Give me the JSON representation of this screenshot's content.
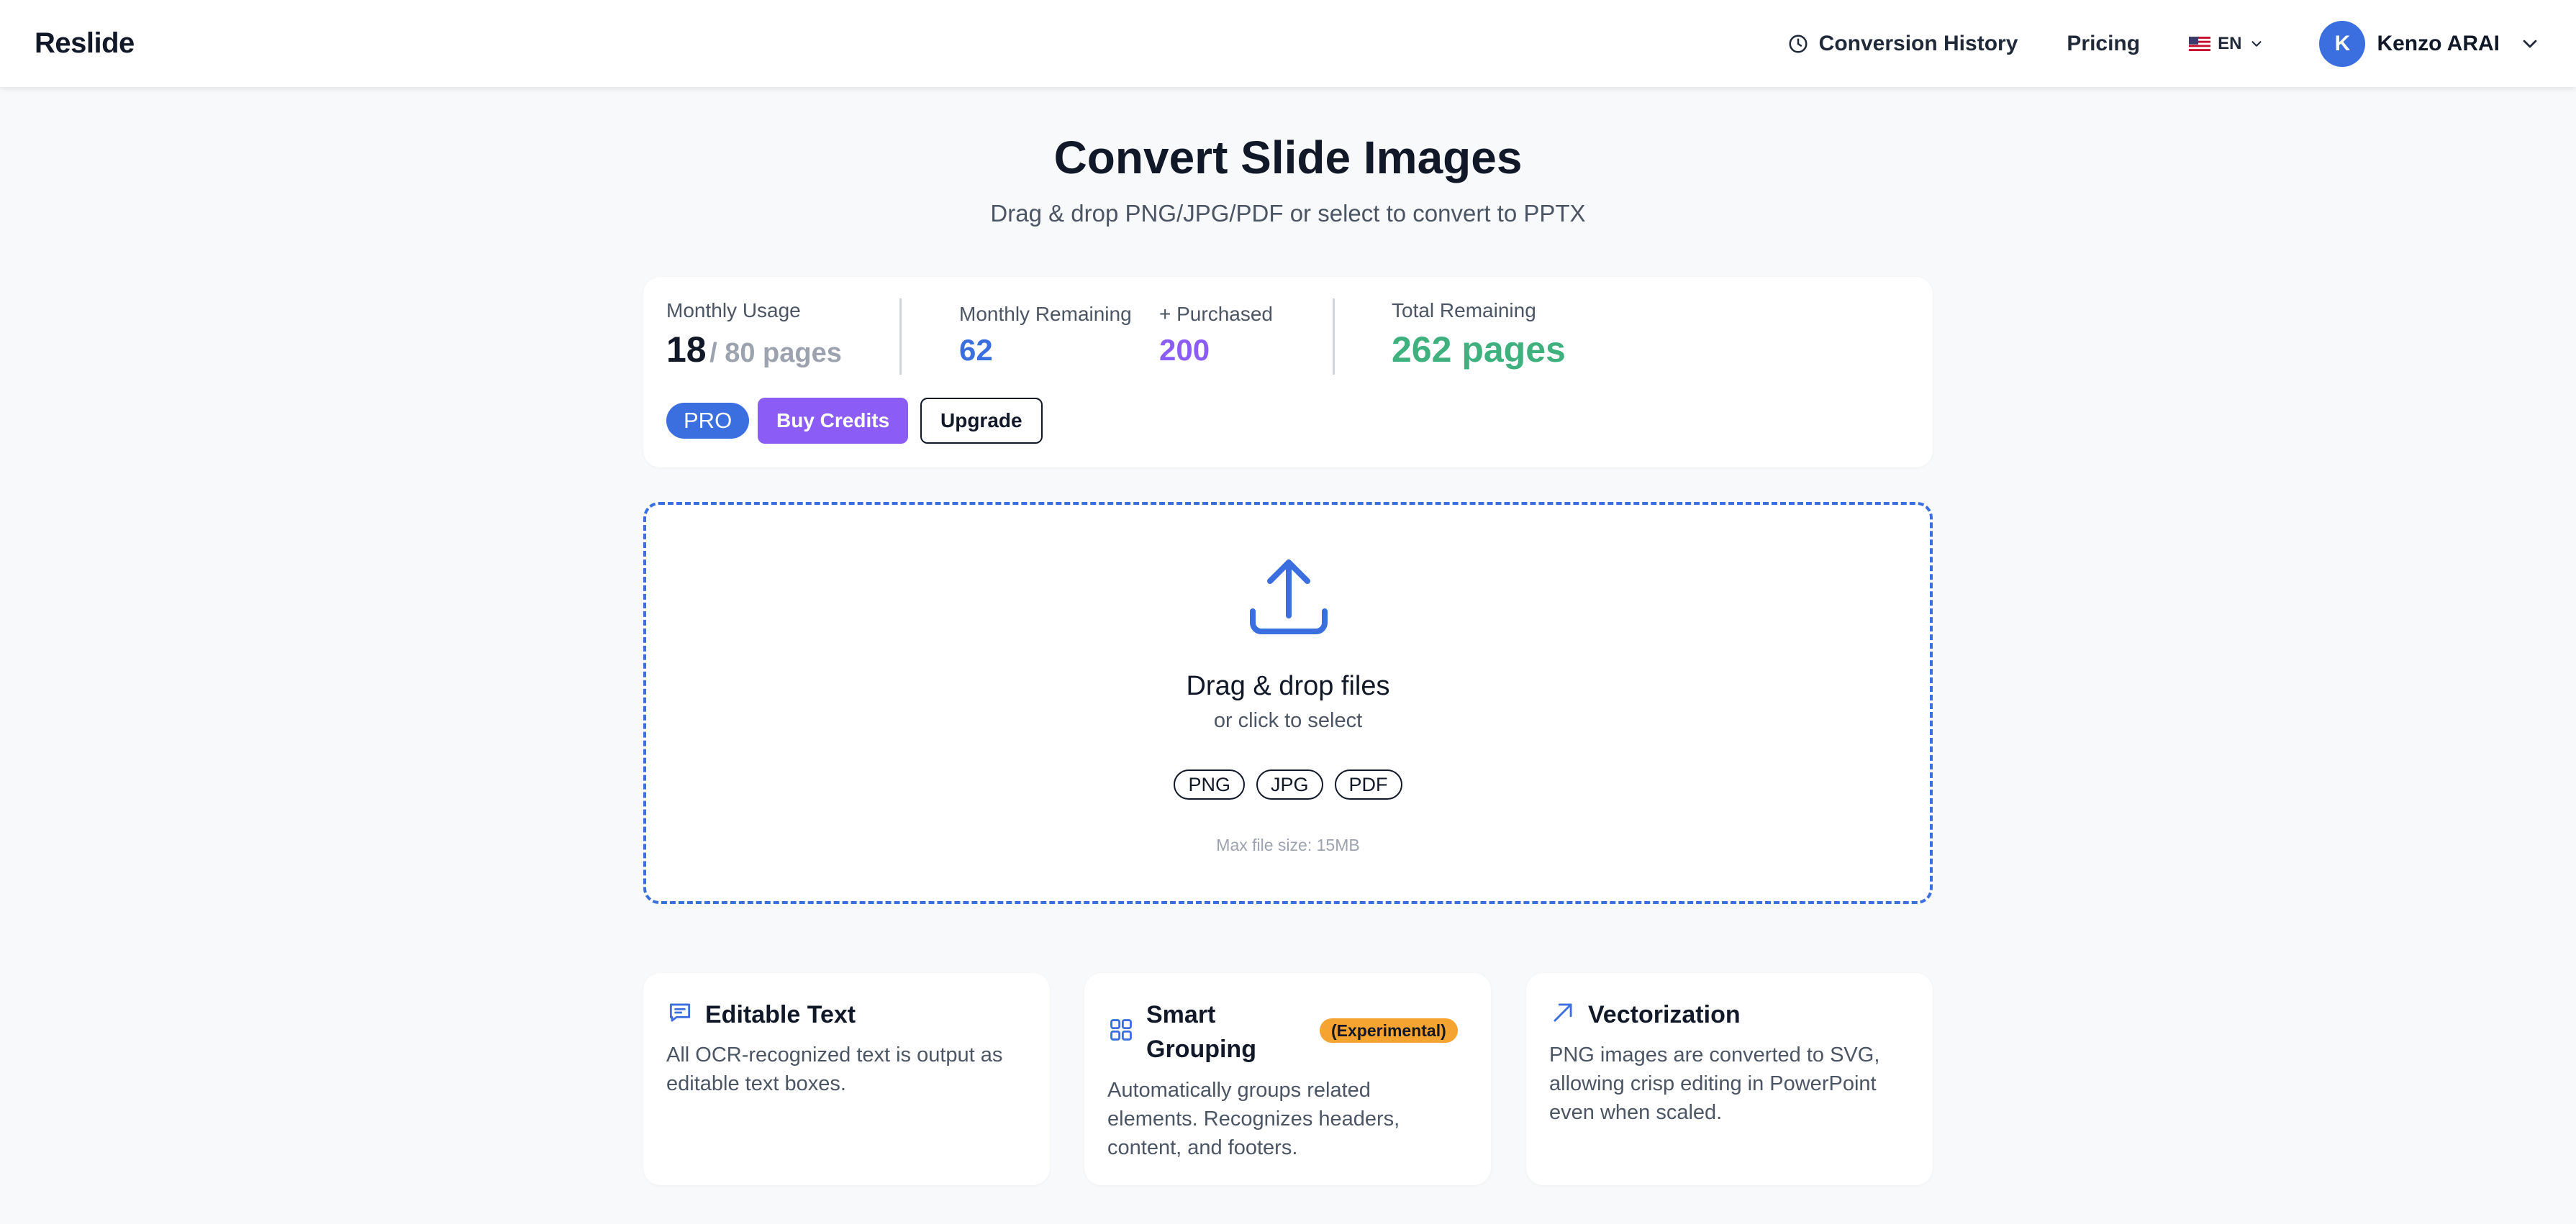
{
  "header": {
    "brand": "Reslide",
    "nav": {
      "history_label": "Conversion History",
      "pricing_label": "Pricing",
      "language_code": "EN",
      "language_flag": "us-flag-icon"
    },
    "user": {
      "initial": "K",
      "name": "Kenzo ARAI"
    }
  },
  "hero": {
    "title": "Convert Slide Images",
    "subtitle": "Drag & drop PNG/JPG/PDF or select to convert to PPTX"
  },
  "usage": {
    "monthly_usage_label": "Monthly Usage",
    "monthly_used": "18",
    "monthly_limit": "/ 80 pages",
    "monthly_remaining_label": "Monthly Remaining",
    "monthly_remaining": "62",
    "purchased_label": "+ Purchased",
    "purchased": "200",
    "total_remaining_label": "Total Remaining",
    "total_remaining": "262 pages",
    "plan_badge": "PRO",
    "buy_credits_label": "Buy Credits",
    "upgrade_label": "Upgrade"
  },
  "dropzone": {
    "title": "Drag & drop files",
    "subtitle": "or click to select",
    "formats": [
      "PNG",
      "JPG",
      "PDF"
    ],
    "max_size": "Max file size: 15MB"
  },
  "features": [
    {
      "icon": "message-icon",
      "title": "Editable Text",
      "description": "All OCR-recognized text is output as editable text boxes."
    },
    {
      "icon": "grid-icon",
      "title": "Smart Grouping",
      "badge": "(Experimental)",
      "description": "Automatically groups related elements. Recognizes headers, content, and footers."
    },
    {
      "icon": "arrow-up-right-icon",
      "title": "Vectorization",
      "description": "PNG images are converted to SVG, allowing crisp editing in PowerPoint even when scaled."
    }
  ],
  "colors": {
    "accent_blue": "#3b6fe0",
    "accent_purple": "#8b5cf6",
    "accent_green": "#3fb17f",
    "badge_orange": "#f5a431"
  }
}
